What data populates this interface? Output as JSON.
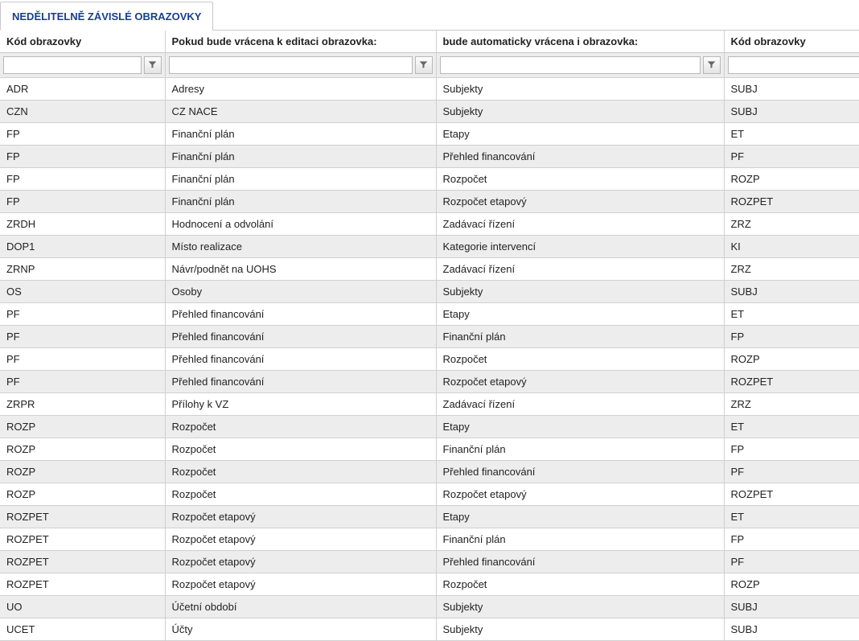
{
  "tab": {
    "label": "NEDĚLITELNĚ ZÁVISLÉ OBRAZOVKY"
  },
  "columns": {
    "col1": "Kód obrazovky",
    "col2": "Pokud bude vrácena k editaci obrazovka:",
    "col3": "bude automaticky vrácena i obrazovka:",
    "col4": "Kód obrazovky"
  },
  "filters": {
    "f1": "",
    "f2": "",
    "f3": "",
    "f4": ""
  },
  "rows": [
    {
      "c1": "ADR",
      "c2": "Adresy",
      "c3": "Subjekty",
      "c4": "SUBJ"
    },
    {
      "c1": "CZN",
      "c2": "CZ NACE",
      "c3": "Subjekty",
      "c4": "SUBJ"
    },
    {
      "c1": "FP",
      "c2": "Finanční plán",
      "c3": "Etapy",
      "c4": "ET"
    },
    {
      "c1": "FP",
      "c2": "Finanční plán",
      "c3": "Přehled financování",
      "c4": "PF"
    },
    {
      "c1": "FP",
      "c2": "Finanční plán",
      "c3": "Rozpočet",
      "c4": "ROZP"
    },
    {
      "c1": "FP",
      "c2": "Finanční plán",
      "c3": "Rozpočet etapový",
      "c4": "ROZPET"
    },
    {
      "c1": "ZRDH",
      "c2": "Hodnocení a odvolání",
      "c3": "Zadávací řízení",
      "c4": "ZRZ"
    },
    {
      "c1": "DOP1",
      "c2": "Místo realizace",
      "c3": "Kategorie intervencí",
      "c4": "KI"
    },
    {
      "c1": "ZRNP",
      "c2": "Návr/podnět na UOHS",
      "c3": "Zadávací řízení",
      "c4": "ZRZ"
    },
    {
      "c1": "OS",
      "c2": "Osoby",
      "c3": "Subjekty",
      "c4": "SUBJ"
    },
    {
      "c1": "PF",
      "c2": "Přehled financování",
      "c3": "Etapy",
      "c4": "ET"
    },
    {
      "c1": "PF",
      "c2": "Přehled financování",
      "c3": "Finanční plán",
      "c4": "FP"
    },
    {
      "c1": "PF",
      "c2": "Přehled financování",
      "c3": "Rozpočet",
      "c4": "ROZP"
    },
    {
      "c1": "PF",
      "c2": "Přehled financování",
      "c3": "Rozpočet etapový",
      "c4": "ROZPET"
    },
    {
      "c1": "ZRPR",
      "c2": "Přílohy k VZ",
      "c3": "Zadávací řízení",
      "c4": "ZRZ"
    },
    {
      "c1": "ROZP",
      "c2": "Rozpočet",
      "c3": "Etapy",
      "c4": "ET"
    },
    {
      "c1": "ROZP",
      "c2": "Rozpočet",
      "c3": "Finanční plán",
      "c4": "FP"
    },
    {
      "c1": "ROZP",
      "c2": "Rozpočet",
      "c3": "Přehled financování",
      "c4": "PF"
    },
    {
      "c1": "ROZP",
      "c2": "Rozpočet",
      "c3": "Rozpočet etapový",
      "c4": "ROZPET"
    },
    {
      "c1": "ROZPET",
      "c2": "Rozpočet etapový",
      "c3": "Etapy",
      "c4": "ET"
    },
    {
      "c1": "ROZPET",
      "c2": "Rozpočet etapový",
      "c3": "Finanční plán",
      "c4": "FP"
    },
    {
      "c1": "ROZPET",
      "c2": "Rozpočet etapový",
      "c3": "Přehled financování",
      "c4": "PF"
    },
    {
      "c1": "ROZPET",
      "c2": "Rozpočet etapový",
      "c3": "Rozpočet",
      "c4": "ROZP"
    },
    {
      "c1": "UO",
      "c2": "Účetní období",
      "c3": "Subjekty",
      "c4": "SUBJ"
    },
    {
      "c1": "UCET",
      "c2": "Účty",
      "c3": "Subjekty",
      "c4": "SUBJ"
    }
  ]
}
